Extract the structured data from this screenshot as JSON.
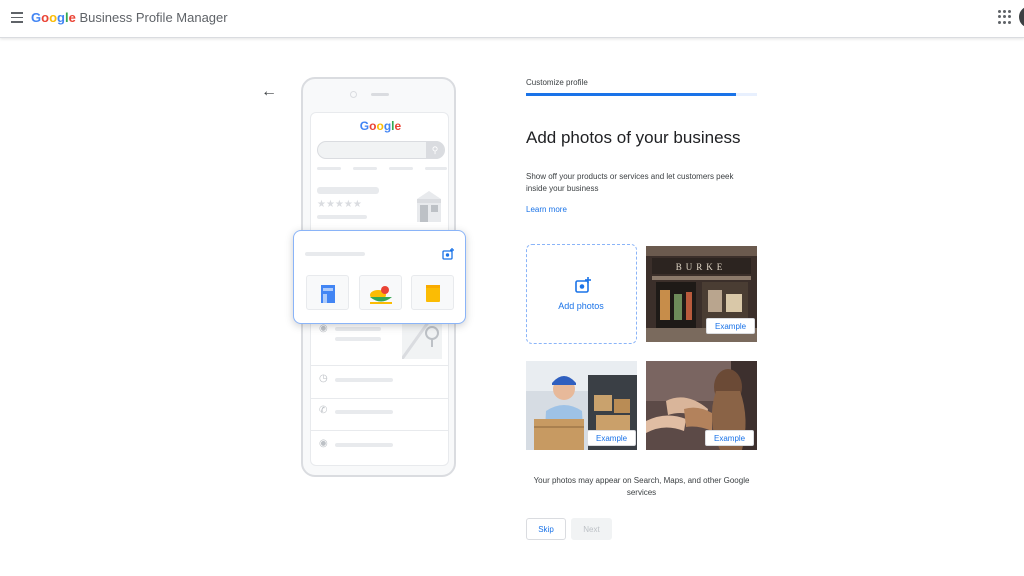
{
  "header": {
    "logo_letters": [
      {
        "ch": "G",
        "color": "#4285F4"
      },
      {
        "ch": "o",
        "color": "#EA4335"
      },
      {
        "ch": "o",
        "color": "#FBBC05"
      },
      {
        "ch": "g",
        "color": "#4285F4"
      },
      {
        "ch": "l",
        "color": "#34A853"
      },
      {
        "ch": "e",
        "color": "#EA4335"
      }
    ],
    "app_name": "Business Profile Manager",
    "menu_icon": "hamburger-menu-icon",
    "apps_icon": "apps-grid-icon"
  },
  "illustration": {
    "search_brand": "Google",
    "rating_stars": "★★★★★"
  },
  "main": {
    "step_label": "Customize profile",
    "progress_fraction": 0.91,
    "title": "Add photos of your business",
    "description": "Show off your products or services and let customers peek inside your business",
    "learn_more": "Learn more",
    "add_photos_label": "Add photos",
    "example_label": "Example",
    "shop_sign": "BURKE",
    "footnote": "Your photos may appear on Search, Maps, and other Google services",
    "skip_label": "Skip",
    "next_label": "Next"
  },
  "colors": {
    "accent": "#1a73e8",
    "progress_track": "#e8f0fe",
    "disabled_bg": "#f1f3f4"
  }
}
